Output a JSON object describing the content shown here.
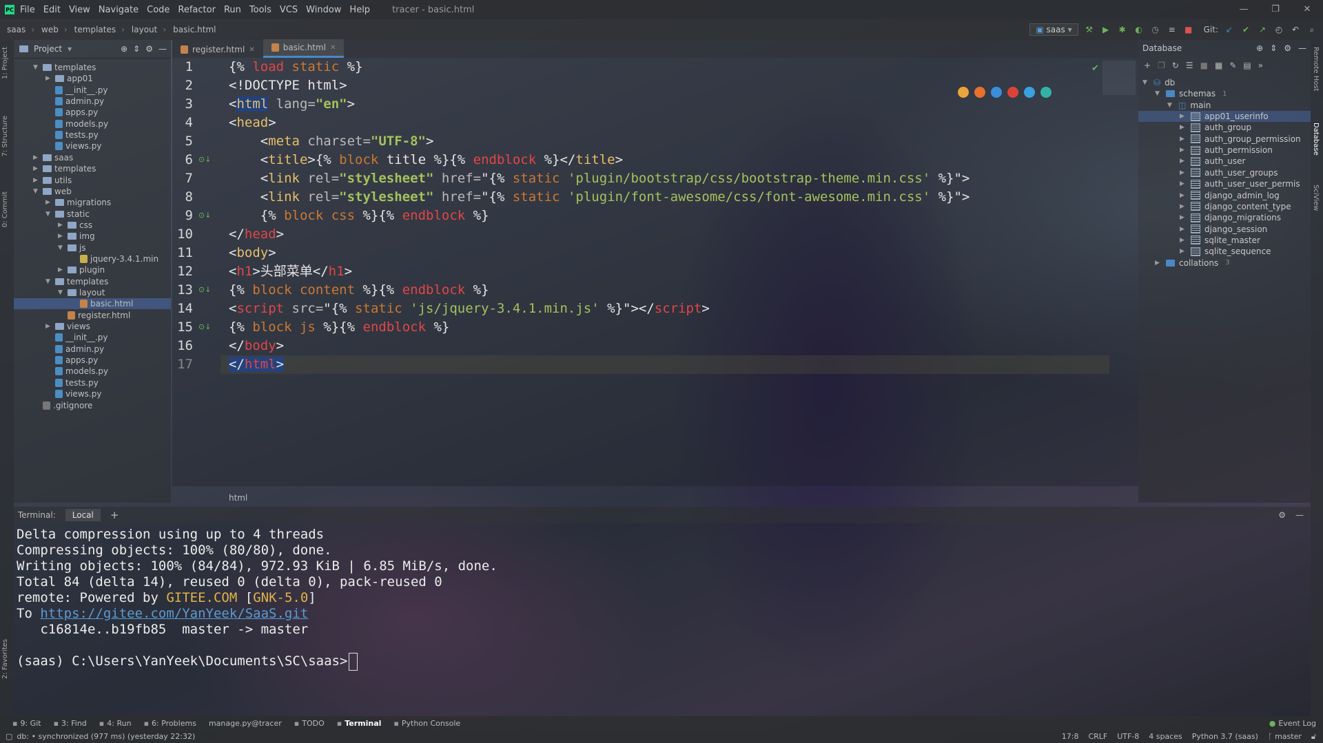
{
  "menubar": {
    "items": [
      "File",
      "Edit",
      "View",
      "Navigate",
      "Code",
      "Refactor",
      "Run",
      "Tools",
      "VCS",
      "Window",
      "Help"
    ],
    "title": "tracer - basic.html",
    "logo": "PC"
  },
  "navbar": {
    "crumbs": [
      "saas",
      "web",
      "templates",
      "layout",
      "basic.html"
    ],
    "run_config": "saas",
    "git_label": "Git:"
  },
  "leftstrip": {
    "tabs": [
      "1: Project",
      "7: Structure",
      "0: Commit",
      "2: Favorites"
    ]
  },
  "project": {
    "title": "Project",
    "items": [
      {
        "label": "templates",
        "type": "folder",
        "indent": 0,
        "open": true
      },
      {
        "label": "app01",
        "type": "folder",
        "indent": 1,
        "open": false
      },
      {
        "label": "__init__.py",
        "type": "py",
        "indent": 1
      },
      {
        "label": "admin.py",
        "type": "py",
        "indent": 1
      },
      {
        "label": "apps.py",
        "type": "py",
        "indent": 1
      },
      {
        "label": "models.py",
        "type": "py",
        "indent": 1
      },
      {
        "label": "tests.py",
        "type": "py",
        "indent": 1
      },
      {
        "label": "views.py",
        "type": "py",
        "indent": 1
      },
      {
        "label": "saas",
        "type": "folder",
        "indent": 0,
        "open": false
      },
      {
        "label": "templates",
        "type": "folder",
        "indent": 0,
        "open": false
      },
      {
        "label": "utils",
        "type": "folder",
        "indent": 0,
        "open": false
      },
      {
        "label": "web",
        "type": "folder",
        "indent": 0,
        "open": true
      },
      {
        "label": "migrations",
        "type": "folder",
        "indent": 1,
        "open": false
      },
      {
        "label": "static",
        "type": "folder",
        "indent": 1,
        "open": true
      },
      {
        "label": "css",
        "type": "folder",
        "indent": 2,
        "open": false
      },
      {
        "label": "img",
        "type": "folder",
        "indent": 2,
        "open": false
      },
      {
        "label": "js",
        "type": "folder",
        "indent": 2,
        "open": true
      },
      {
        "label": "jquery-3.4.1.min",
        "type": "js",
        "indent": 3
      },
      {
        "label": "plugin",
        "type": "folder",
        "indent": 2,
        "open": false
      },
      {
        "label": "templates",
        "type": "folder",
        "indent": 1,
        "open": true
      },
      {
        "label": "layout",
        "type": "folder",
        "indent": 2,
        "open": true
      },
      {
        "label": "basic.html",
        "type": "html",
        "indent": 3,
        "selected": true
      },
      {
        "label": "register.html",
        "type": "html",
        "indent": 2
      },
      {
        "label": "views",
        "type": "folder",
        "indent": 1,
        "open": false
      },
      {
        "label": "__init__.py",
        "type": "py",
        "indent": 1
      },
      {
        "label": "admin.py",
        "type": "py",
        "indent": 1
      },
      {
        "label": "apps.py",
        "type": "py",
        "indent": 1
      },
      {
        "label": "models.py",
        "type": "py",
        "indent": 1
      },
      {
        "label": "tests.py",
        "type": "py",
        "indent": 1
      },
      {
        "label": "views.py",
        "type": "py",
        "indent": 1
      },
      {
        "label": ".gitignore",
        "type": "git",
        "indent": 0
      }
    ]
  },
  "editor": {
    "tabs": [
      {
        "label": "register.html",
        "active": false
      },
      {
        "label": "basic.html",
        "active": true
      }
    ],
    "line_numbers": [
      "1",
      "2",
      "3",
      "4",
      "5",
      "6",
      "7",
      "8",
      "9",
      "10",
      "11",
      "12",
      "13",
      "14",
      "15",
      "16",
      "17"
    ],
    "breadcrumb": "html",
    "lines": [
      [
        {
          "t": "{% ",
          "c": "plain"
        },
        {
          "t": "load",
          "c": "end"
        },
        {
          "t": " static ",
          "c": "tpl"
        },
        {
          "t": "%}",
          "c": "plain"
        }
      ],
      [
        {
          "t": "<!DOCTYPE html>",
          "c": "plain"
        }
      ],
      [
        {
          "t": "<",
          "c": "plain"
        },
        {
          "t": "html",
          "c": "tag"
        },
        {
          "t": " lang=",
          "c": "attr"
        },
        {
          "t": "\"en\"",
          "c": "str"
        },
        {
          "t": ">",
          "c": "plain"
        }
      ],
      [
        {
          "t": "<",
          "c": "plain"
        },
        {
          "t": "head",
          "c": "tag"
        },
        {
          "t": ">",
          "c": "plain"
        }
      ],
      [
        {
          "t": "    <",
          "c": "plain"
        },
        {
          "t": "meta",
          "c": "tag"
        },
        {
          "t": " charset=",
          "c": "attr"
        },
        {
          "t": "\"UTF-8\"",
          "c": "str"
        },
        {
          "t": ">",
          "c": "plain"
        }
      ],
      [
        {
          "t": "    <",
          "c": "plain"
        },
        {
          "t": "title",
          "c": "tag"
        },
        {
          "t": ">{% ",
          "c": "plain"
        },
        {
          "t": "block",
          "c": "tpl"
        },
        {
          "t": " title ",
          "c": "plain"
        },
        {
          "t": "%}{% ",
          "c": "plain"
        },
        {
          "t": "endblock",
          "c": "end"
        },
        {
          "t": " %}</",
          "c": "plain"
        },
        {
          "t": "title",
          "c": "tag"
        },
        {
          "t": ">",
          "c": "plain"
        }
      ],
      [
        {
          "t": "    <",
          "c": "plain"
        },
        {
          "t": "link",
          "c": "tag"
        },
        {
          "t": " rel=",
          "c": "attr"
        },
        {
          "t": "\"stylesheet\"",
          "c": "str"
        },
        {
          "t": " href=",
          "c": "attr"
        },
        {
          "t": "\"{% ",
          "c": "plain"
        },
        {
          "t": "static",
          "c": "tpl"
        },
        {
          "t": " 'plugin/bootstrap/css/bootstrap-theme.min.css'",
          "c": "sq"
        },
        {
          "t": " %}\">",
          "c": "plain"
        }
      ],
      [
        {
          "t": "    <",
          "c": "plain"
        },
        {
          "t": "link",
          "c": "tag"
        },
        {
          "t": " rel=",
          "c": "attr"
        },
        {
          "t": "\"stylesheet\"",
          "c": "str"
        },
        {
          "t": " href=",
          "c": "attr"
        },
        {
          "t": "\"{% ",
          "c": "plain"
        },
        {
          "t": "static",
          "c": "tpl"
        },
        {
          "t": " 'plugin/font-awesome/css/font-awesome.min.css'",
          "c": "sq"
        },
        {
          "t": " %}\">",
          "c": "plain"
        }
      ],
      [
        {
          "t": "    {% ",
          "c": "plain"
        },
        {
          "t": "block",
          "c": "tpl"
        },
        {
          "t": " css ",
          "c": "tpl"
        },
        {
          "t": "%}{% ",
          "c": "plain"
        },
        {
          "t": "endblock",
          "c": "end"
        },
        {
          "t": " %}",
          "c": "plain"
        }
      ],
      [
        {
          "t": "</",
          "c": "plain"
        },
        {
          "t": "head",
          "c": "end"
        },
        {
          "t": ">",
          "c": "plain"
        }
      ],
      [
        {
          "t": "<",
          "c": "plain"
        },
        {
          "t": "body",
          "c": "tag"
        },
        {
          "t": ">",
          "c": "plain"
        }
      ],
      [
        {
          "t": "<",
          "c": "plain"
        },
        {
          "t": "h1",
          "c": "end"
        },
        {
          "t": ">头部菜单</",
          "c": "plain"
        },
        {
          "t": "h1",
          "c": "end"
        },
        {
          "t": ">",
          "c": "plain"
        }
      ],
      [
        {
          "t": "{% ",
          "c": "plain"
        },
        {
          "t": "block",
          "c": "tpl"
        },
        {
          "t": " content ",
          "c": "tpl"
        },
        {
          "t": "%}{% ",
          "c": "plain"
        },
        {
          "t": "endblock",
          "c": "end"
        },
        {
          "t": " %}",
          "c": "plain"
        }
      ],
      [
        {
          "t": "<",
          "c": "plain"
        },
        {
          "t": "script",
          "c": "end"
        },
        {
          "t": " src=",
          "c": "attr"
        },
        {
          "t": "\"{% ",
          "c": "plain"
        },
        {
          "t": "static",
          "c": "tpl"
        },
        {
          "t": " 'js/jquery-3.4.1.min.js'",
          "c": "sq"
        },
        {
          "t": " %}\"></",
          "c": "plain"
        },
        {
          "t": "script",
          "c": "end"
        },
        {
          "t": ">",
          "c": "plain"
        }
      ],
      [
        {
          "t": "{% ",
          "c": "plain"
        },
        {
          "t": "block",
          "c": "tpl"
        },
        {
          "t": " js ",
          "c": "tpl"
        },
        {
          "t": "%}{% ",
          "c": "plain"
        },
        {
          "t": "endblock",
          "c": "end"
        },
        {
          "t": " %}",
          "c": "plain"
        }
      ],
      [
        {
          "t": "</",
          "c": "plain"
        },
        {
          "t": "body",
          "c": "end"
        },
        {
          "t": ">",
          "c": "plain"
        }
      ],
      [
        {
          "t": "</",
          "c": "plain"
        },
        {
          "t": "html",
          "c": "end"
        },
        {
          "t": ">",
          "c": "plain"
        }
      ]
    ]
  },
  "database": {
    "title": "Database",
    "items": [
      {
        "label": "db",
        "indent": 0,
        "kind": "db"
      },
      {
        "label": "schemas",
        "count": "1",
        "indent": 1,
        "kind": "folder"
      },
      {
        "label": "main",
        "indent": 2,
        "kind": "schema"
      },
      {
        "label": "app01_userinfo",
        "indent": 3,
        "kind": "table",
        "selected": true
      },
      {
        "label": "auth_group",
        "indent": 3,
        "kind": "table"
      },
      {
        "label": "auth_group_permission",
        "indent": 3,
        "kind": "table"
      },
      {
        "label": "auth_permission",
        "indent": 3,
        "kind": "table"
      },
      {
        "label": "auth_user",
        "indent": 3,
        "kind": "table"
      },
      {
        "label": "auth_user_groups",
        "indent": 3,
        "kind": "table"
      },
      {
        "label": "auth_user_user_permis",
        "indent": 3,
        "kind": "table"
      },
      {
        "label": "django_admin_log",
        "indent": 3,
        "kind": "table"
      },
      {
        "label": "django_content_type",
        "indent": 3,
        "kind": "table"
      },
      {
        "label": "django_migrations",
        "indent": 3,
        "kind": "table"
      },
      {
        "label": "django_session",
        "indent": 3,
        "kind": "table"
      },
      {
        "label": "sqlite_master",
        "indent": 3,
        "kind": "table"
      },
      {
        "label": "sqlite_sequence",
        "indent": 3,
        "kind": "table"
      },
      {
        "label": "collations",
        "count": "3",
        "indent": 1,
        "kind": "folder"
      }
    ]
  },
  "rightstrip": {
    "tabs": [
      "Remote Host",
      "Database",
      "SciView"
    ]
  },
  "terminal": {
    "label": "Terminal:",
    "tab": "Local",
    "add": "+",
    "lines": [
      [
        {
          "t": "Delta compression using up to 4 threads",
          "c": "plain"
        }
      ],
      [
        {
          "t": "Compressing objects: 100% (80/80), done.",
          "c": "plain"
        }
      ],
      [
        {
          "t": "Writing objects: 100% (84/84), 972.93 KiB | 6.85 MiB/s, done.",
          "c": "plain"
        }
      ],
      [
        {
          "t": "Total 84 (delta 14), reused 0 (delta 0), pack-reused 0",
          "c": "plain"
        }
      ],
      [
        {
          "t": "remote: Powered by ",
          "c": "plain"
        },
        {
          "t": "GITEE.COM",
          "c": "orange"
        },
        {
          "t": " [",
          "c": "plain"
        },
        {
          "t": "GNK-5.0",
          "c": "orange"
        },
        {
          "t": "]",
          "c": "plain"
        }
      ],
      [
        {
          "t": "To ",
          "c": "plain"
        },
        {
          "t": "https://gitee.com/YanYeek/SaaS.git",
          "c": "link"
        }
      ],
      [
        {
          "t": "   c16814e..b19fb85  master -> master",
          "c": "plain"
        }
      ],
      [
        {
          "t": "",
          "c": "plain"
        }
      ],
      [
        {
          "t": "(saas) C:\\Users\\YanYeek\\Documents\\SC\\saas>",
          "c": "plain"
        }
      ]
    ]
  },
  "toolwindows": [
    {
      "label": "9: Git",
      "icon": "git-icon"
    },
    {
      "label": "3: Find",
      "icon": "find-icon"
    },
    {
      "label": "4: Run",
      "icon": "run-icon"
    },
    {
      "label": "6: Problems",
      "icon": "problems-icon"
    },
    {
      "label": "manage.py@tracer",
      "icon": ""
    },
    {
      "label": "TODO",
      "icon": "todo-icon"
    },
    {
      "label": "Terminal",
      "icon": "terminal-icon",
      "active": true
    },
    {
      "label": "Python Console",
      "icon": "python-icon"
    }
  ],
  "event_log": "Event Log",
  "status": {
    "left": "db: • synchronized (977 ms) (yesterday 22:32)",
    "position": "17:8",
    "line_sep": "CRLF",
    "encoding": "UTF-8",
    "indent": "4 spaces",
    "interpreter": "Python 3.7 (saas)",
    "branch": "master"
  }
}
